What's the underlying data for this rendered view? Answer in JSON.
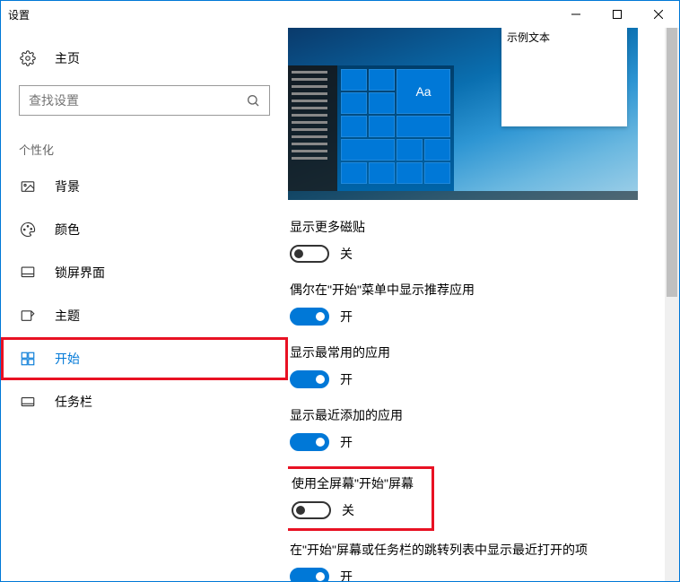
{
  "window": {
    "title": "设置"
  },
  "sidebar": {
    "home": "主页",
    "search_placeholder": "查找设置",
    "section": "个性化",
    "items": [
      {
        "label": "背景"
      },
      {
        "label": "颜色"
      },
      {
        "label": "锁屏界面"
      },
      {
        "label": "主题"
      },
      {
        "label": "开始"
      },
      {
        "label": "任务栏"
      }
    ]
  },
  "preview": {
    "tooltip": "示例文本",
    "tile_label": "Aa"
  },
  "settings": [
    {
      "label": "显示更多磁贴",
      "state": "off",
      "text": "关"
    },
    {
      "label": "偶尔在\"开始\"菜单中显示推荐应用",
      "state": "on",
      "text": "开"
    },
    {
      "label": "显示最常用的应用",
      "state": "on",
      "text": "开"
    },
    {
      "label": "显示最近添加的应用",
      "state": "on",
      "text": "开"
    },
    {
      "label": "使用全屏幕\"开始\"屏幕",
      "state": "off",
      "text": "关"
    },
    {
      "label": "在\"开始\"屏幕或任务栏的跳转列表中显示最近打开的项",
      "state": "on",
      "text": "开"
    }
  ]
}
